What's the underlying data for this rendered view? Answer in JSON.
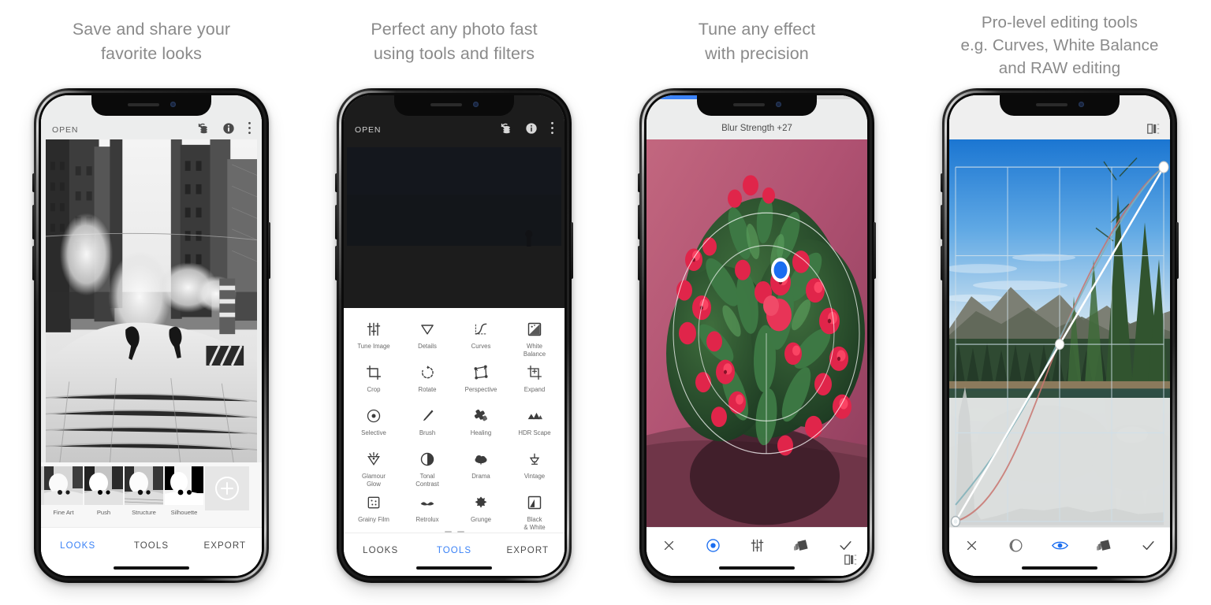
{
  "panels": [
    {
      "caption": "Save and share your\nfavorite looks",
      "topbar": {
        "open_label": "OPEN",
        "icons": [
          "undo-history-icon",
          "info-icon",
          "overflow-menu-icon"
        ]
      },
      "photo": {
        "name": "black-and-white-city-street-steam-photo",
        "description": "Black and white photo of a snowy city street with steam"
      },
      "looks": [
        {
          "label": "",
          "name": "look-thumb-partial"
        },
        {
          "label": "Fine Art",
          "name": "look-thumb-fine-art"
        },
        {
          "label": "Push",
          "name": "look-thumb-push"
        },
        {
          "label": "Structure",
          "name": "look-thumb-structure"
        },
        {
          "label": "Silhouette",
          "name": "look-thumb-silhouette"
        }
      ],
      "add_look_label": "+",
      "bottom_nav": [
        {
          "label": "LOOKS",
          "active": true
        },
        {
          "label": "TOOLS",
          "active": false
        },
        {
          "label": "EXPORT",
          "active": false
        }
      ]
    },
    {
      "caption": "Perfect any photo fast\nusing tools and filters",
      "topbar": {
        "open_label": "OPEN",
        "icons": [
          "undo-history-icon",
          "info-icon",
          "overflow-menu-icon"
        ]
      },
      "tools": [
        {
          "label": "Tune Image",
          "icon": "tune-sliders-icon"
        },
        {
          "label": "Details",
          "icon": "triangle-details-icon"
        },
        {
          "label": "Curves",
          "icon": "curves-icon"
        },
        {
          "label": "White\nBalance",
          "icon": "white-balance-icon"
        },
        {
          "label": "Crop",
          "icon": "crop-icon"
        },
        {
          "label": "Rotate",
          "icon": "rotate-icon"
        },
        {
          "label": "Perspective",
          "icon": "perspective-icon"
        },
        {
          "label": "Expand",
          "icon": "expand-icon"
        },
        {
          "label": "Selective",
          "icon": "selective-target-icon"
        },
        {
          "label": "Brush",
          "icon": "brush-icon"
        },
        {
          "label": "Healing",
          "icon": "healing-icon"
        },
        {
          "label": "HDR Scape",
          "icon": "hdr-scape-icon"
        },
        {
          "label": "Glamour\nGlow",
          "icon": "glamour-glow-icon"
        },
        {
          "label": "Tonal\nContrast",
          "icon": "tonal-contrast-icon"
        },
        {
          "label": "Drama",
          "icon": "drama-cloud-icon"
        },
        {
          "label": "Vintage",
          "icon": "vintage-lamp-icon"
        },
        {
          "label": "Grainy Film",
          "icon": "grainy-film-icon"
        },
        {
          "label": "Retrolux",
          "icon": "retrolux-icon"
        },
        {
          "label": "Grunge",
          "icon": "grunge-icon"
        },
        {
          "label": "Black\n& White",
          "icon": "black-and-white-icon"
        }
      ],
      "bottom_nav": [
        {
          "label": "LOOKS",
          "active": false
        },
        {
          "label": "TOOLS",
          "active": true
        },
        {
          "label": "EXPORT",
          "active": false
        }
      ]
    },
    {
      "caption": "Tune any effect\nwith precision",
      "title": "Blur Strength +27",
      "progress_percent": 27,
      "photo": {
        "name": "pink-flowers-crown-of-thorns-photo",
        "description": "Red crown-of-thorns flowers against a pink background"
      },
      "compare_icon": "compare-split-icon",
      "control_point": "selective-control-point",
      "toolbar": [
        {
          "icon": "close-x-icon",
          "active": false
        },
        {
          "icon": "selective-target-icon",
          "active": true
        },
        {
          "icon": "tune-sliders-icon",
          "active": false
        },
        {
          "icon": "stack-layers-icon",
          "active": false
        },
        {
          "icon": "checkmark-icon",
          "active": false
        }
      ]
    },
    {
      "caption": "Pro-level editing tools\ne.g. Curves, White Balance\nand RAW editing",
      "compare_icon": "compare-split-icon",
      "photo": {
        "name": "lake-mountain-pine-trees-photo",
        "description": "Blue sky lake with pine trees and mountains"
      },
      "curves": {
        "name": "tone-curve-editor",
        "grid": true,
        "points": [
          [
            0,
            0
          ],
          [
            0.5,
            0.5
          ],
          [
            1.0,
            1.0
          ]
        ],
        "channels": [
          "luminance",
          "red",
          "blue"
        ],
        "histogram": true
      },
      "toolbar": [
        {
          "icon": "close-x-icon",
          "active": false
        },
        {
          "icon": "contrast-moon-icon",
          "active": false
        },
        {
          "icon": "eye-preview-icon",
          "active": true
        },
        {
          "icon": "stack-layers-icon",
          "active": false
        },
        {
          "icon": "checkmark-icon",
          "active": false
        }
      ]
    }
  ],
  "colors": {
    "accent_blue": "#3b82f6",
    "caption_gray": "#8a8a8a",
    "app_bg": "#eceded",
    "sheet_white": "#ffffff"
  }
}
